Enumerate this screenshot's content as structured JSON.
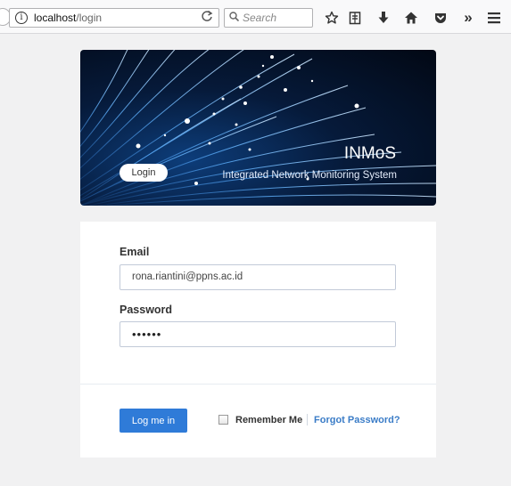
{
  "browser": {
    "url_host": "localhost",
    "url_path": "/login",
    "search_placeholder": "Search",
    "info_icon": "i",
    "reload_icon": "reload-icon",
    "overflow_label": "»"
  },
  "banner": {
    "login_label": "Login",
    "title": "INMoS",
    "subtitle": "Integrated Network Monitoring System"
  },
  "form": {
    "email_label": "Email",
    "email_value": "rona.riantini@ppns.ac.id",
    "password_label": "Password",
    "password_value": "••••••",
    "submit_label": "Log me in",
    "remember_label": "Remember Me",
    "forgot_label": "Forgot Password?",
    "remember_checked": false
  },
  "colors": {
    "primary": "#2f7bd8",
    "link": "#3a7cc7",
    "banner_dark": "#061a3a"
  }
}
